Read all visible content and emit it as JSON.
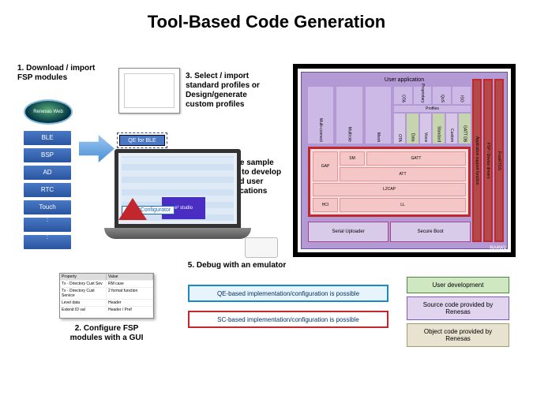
{
  "title": "Tool-Based Code Generation",
  "steps": {
    "s1": "1. Download / import FSP modules",
    "s2": "2. Configure FSP modules with a GUI",
    "s3": "3. Select / import standard profiles or Design/generate custom profiles",
    "s4": "4. Use sample code to develop / build user applications",
    "s5": "5. Debug with an emulator"
  },
  "fsp_modules": [
    "BLE",
    "BSP",
    "AD",
    "RTC",
    "Touch",
    ":",
    ":"
  ],
  "web_label": "Renesas Web",
  "qe_label": "QE for BLE",
  "es_label": "e² studio",
  "sc_label": "SmartConfigurator",
  "cfg_table": {
    "headers": [
      "Property",
      "Value"
    ],
    "rows": [
      [
        "Tx - Directory Cust Sev",
        "RM case"
      ],
      [
        "Tx - Directory Cust Service",
        "2 format function"
      ],
      [
        "Level data",
        "Header"
      ],
      [
        "Extend ID val",
        "Header / Pref"
      ]
    ]
  },
  "panel": {
    "user_app": "User application",
    "top_cols": [
      "Multi-connect",
      "Multirole",
      "Mesh"
    ],
    "prof_label": "Profiles",
    "prof_cols": [
      "OTA",
      "Data",
      "Voice",
      "Standard",
      "Custom",
      "GATT DB"
    ],
    "top_extra": [
      "OTA",
      "Proprietary",
      "QoS",
      "ISO"
    ],
    "side": [
      "Application support function",
      "FSP / Device drivers",
      "FreeRTOS"
    ],
    "mid": {
      "gap": "GAP",
      "sm": "SM",
      "gatt": "GATT",
      "att": "ATT",
      "l2cap": "L2CAP",
      "hci": "HCI",
      "ll": "LL"
    },
    "bottom": [
      "Serial Uploader",
      "Secure Boot"
    ],
    "chip": "RA4W1"
  },
  "impl": {
    "qe": "QE-based implementation/configuration is possible",
    "sc": "SC-based implementation/configuration is possible"
  },
  "legend": {
    "l1": "User development",
    "l2": "Source code provided by Renesas",
    "l3": "Object code provided by Renesas"
  }
}
